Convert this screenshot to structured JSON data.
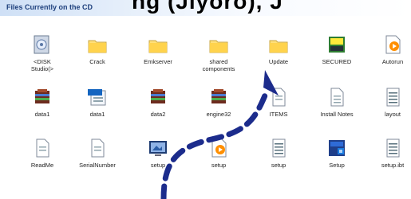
{
  "header": {
    "section_title": "Files Currently on the CD",
    "banner_text": "ng (Jiyoro), J"
  },
  "files": [
    {
      "label": "<DISK\nStudio(>",
      "icon": "disk-app-icon"
    },
    {
      "label": "Crack",
      "icon": "folder-icon"
    },
    {
      "label": "Emkserver",
      "icon": "folder-icon"
    },
    {
      "label": "shared\ncomponents",
      "icon": "folder-icon"
    },
    {
      "label": "Update",
      "icon": "folder-icon"
    },
    {
      "label": "SECURED",
      "icon": "exe-icon"
    },
    {
      "label": "Autorun",
      "icon": "autorun-icon"
    },
    {
      "label": "data1",
      "icon": "rar-archive-icon"
    },
    {
      "label": "data1",
      "icon": "cab-file-icon"
    },
    {
      "label": "data2",
      "icon": "rar-archive-icon"
    },
    {
      "label": "engine32",
      "icon": "rar-archive-icon"
    },
    {
      "label": "ITEMS",
      "icon": "document-icon"
    },
    {
      "label": "Install Notes",
      "icon": "document-icon"
    },
    {
      "label": "layout",
      "icon": "text-file-icon"
    },
    {
      "label": "ReadMe",
      "icon": "document-icon"
    },
    {
      "label": "SerialNumber",
      "icon": "document-icon"
    },
    {
      "label": "setup",
      "icon": "setup-app-icon"
    },
    {
      "label": "setup",
      "icon": "setup-script-icon"
    },
    {
      "label": "setup",
      "icon": "text-file-icon"
    },
    {
      "label": "Setup",
      "icon": "installer-icon"
    },
    {
      "label": "setup.ibt",
      "icon": "text-file-icon"
    }
  ],
  "colors": {
    "annotation_arrow": "#1c2c8c",
    "header_text": "#1d3f7c"
  }
}
